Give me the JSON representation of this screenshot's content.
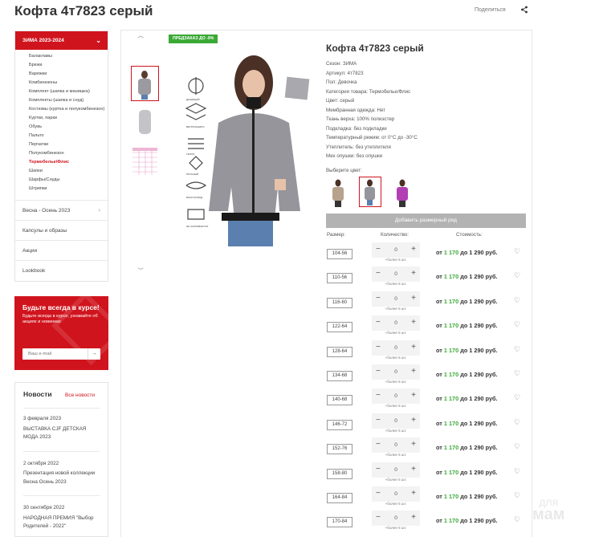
{
  "page": {
    "title": "Кофта 4т7823 серый",
    "share_label": "Поделиться"
  },
  "sidebar": {
    "active": "ЗИМА 2023-2024",
    "sub_items": [
      "Балаклавы",
      "Брюки",
      "Варежки",
      "Комбинезоны",
      "Комплект (шапка и манишка)",
      "Комплекты (шапка и снуд)",
      "Костюмы (куртка и полукомбинезон)",
      "Куртки, парки",
      "Обувь",
      "Пальто",
      "Перчатки",
      "Полукомбинезон",
      "Термобелье/Флис",
      "Шапки",
      "Шарфы/Снуды",
      "Штрипки"
    ],
    "active_sub": "Термобелье/Флис",
    "items": [
      "Весна - Осень 2023",
      "Капсулы и образы",
      "Акции",
      "Lookbook"
    ]
  },
  "subscribe": {
    "title": "Будьте всегда в курсе!",
    "text": "Будьте всегда в курсе, узнавайте об акциях и новинках",
    "placeholder": "Ваш e-mail"
  },
  "news": {
    "title": "Новости",
    "all_label": "Все новости",
    "items": [
      {
        "date": "3 февраля 2023",
        "text": "ВЫСТАВКА CJF ДЕТСКАЯ МОДА 2023"
      },
      {
        "date": "2 октября 2022",
        "text": "Презентация новой коллекции Весна Осень 2023"
      },
      {
        "date": "30 сентября 2022",
        "text": "НАРОДНАЯ ПРЕМИЯ \"Выбор Родителей - 2022\""
      }
    ]
  },
  "product": {
    "promo": "ПРЕДЗАКАЗ ДО -9%",
    "title": "Кофта 4т7823 серый",
    "attributes": [
      "Сезон: ЗИМА",
      "Артикул: 4т7823",
      "Пол: Девочка",
      "Категория товара: Термобелье/Флис",
      "Цвет: серый",
      "Мембранная одежда: Нет",
      "Ткань верха: 100% полиэстер",
      "Подкладка: без подкладки",
      "Температурный режим: от 0°С до -30°С",
      "Утеплитель: без утеплителя",
      "Мех опушки: без опушки"
    ],
    "choose_color": "Выберите цвет:",
    "add_size_row": "Добавить размерный ряд",
    "col_size": "Размер:",
    "col_qty": "Количество:",
    "col_cost": "Стоимость:",
    "more_label": "+более 5 шт.",
    "rows": [
      {
        "size": "104-56",
        "qty": "0",
        "price_from": "от",
        "price_green": "1 170",
        "price_to": "до 1 290 руб."
      },
      {
        "size": "110-56",
        "qty": "0",
        "price_from": "от",
        "price_green": "1 170",
        "price_to": "до 1 290 руб."
      },
      {
        "size": "116-60",
        "qty": "0",
        "price_from": "от",
        "price_green": "1 170",
        "price_to": "до 1 290 руб."
      },
      {
        "size": "122-64",
        "qty": "0",
        "price_from": "от",
        "price_green": "1 170",
        "price_to": "до 1 290 руб."
      },
      {
        "size": "128-64",
        "qty": "0",
        "price_from": "от",
        "price_green": "1 170",
        "price_to": "до 1 290 руб."
      },
      {
        "size": "134-68",
        "qty": "0",
        "price_from": "от",
        "price_green": "1 170",
        "price_to": "до 1 290 руб."
      },
      {
        "size": "140-68",
        "qty": "0",
        "price_from": "от",
        "price_green": "1 170",
        "price_to": "до 1 290 руб."
      },
      {
        "size": "146-72",
        "qty": "0",
        "price_from": "от",
        "price_green": "1 170",
        "price_to": "до 1 290 руб."
      },
      {
        "size": "152-76",
        "qty": "0",
        "price_from": "от",
        "price_green": "1 170",
        "price_to": "до 1 290 руб."
      },
      {
        "size": "158-80",
        "qty": "0",
        "price_from": "от",
        "price_green": "1 170",
        "price_to": "до 1 290 руб."
      },
      {
        "size": "164-84",
        "qty": "0",
        "price_from": "от",
        "price_green": "1 170",
        "price_to": "до 1 290 руб."
      },
      {
        "size": "170-84",
        "qty": "0",
        "price_from": "от",
        "price_green": "1 170",
        "price_to": "до 1 290 руб."
      }
    ]
  },
  "watermark": {
    "line1": "для",
    "line2": "мам"
  },
  "colors": {
    "accent": "#d0141d",
    "price_green": "#3aa935",
    "button_gray": "#b3b3b3"
  }
}
